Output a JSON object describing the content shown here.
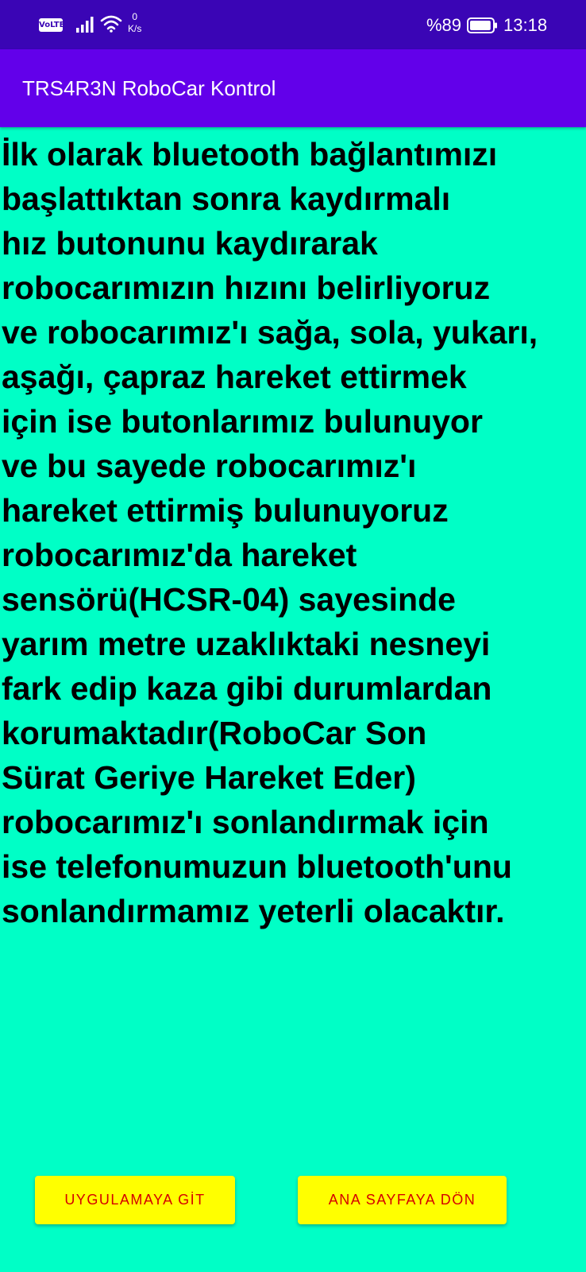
{
  "status_bar": {
    "volte": "VoLTE",
    "net_speed_value": "0",
    "net_speed_unit": "K/s",
    "battery_percent": "%89",
    "battery_level": 0.89,
    "time": "13:18"
  },
  "app_bar": {
    "title": "TRS4R3N RoboCar Kontrol"
  },
  "content": {
    "text": "İlk olarak bluetooth bağlantımızı\nbaşlattıktan sonra kaydırmalı\nhız butonunu kaydırarak\nrobocarımızın hızını belirliyoruz\nve robocarımız'ı sağa, sola, yukarı,\naşağı, çapraz hareket ettirmek\niçin ise butonlarımız bulunuyor\nve bu sayede robocarımız'ı\nhareket ettirmiş bulunuyoruz\nrobocarımız'da hareket\nsensörü(HCSR-04) sayesinde\nyarım metre uzaklıktaki nesneyi\nfark edip kaza gibi durumlardan\nkorumaktadır(RoboCar Son\nSürat Geriye Hareket Eder)\nrobocarımız'ı sonlandırmak için\nise telefonumuzun bluetooth'unu\nsonlandırmamız yeterli olacaktır."
  },
  "buttons": {
    "go_to_app": "UYGULAMAYA GİT",
    "back_home": "ANA SAYFAYA DÖN"
  },
  "colors": {
    "status_bar": "#3a05b5",
    "app_bar": "#6200ea",
    "background": "#00ffc6",
    "button_bg": "#ffff00",
    "button_text": "#d50000"
  },
  "icons": {
    "signal": "signal-bars-icon",
    "wifi": "wifi-icon",
    "battery": "battery-icon"
  }
}
